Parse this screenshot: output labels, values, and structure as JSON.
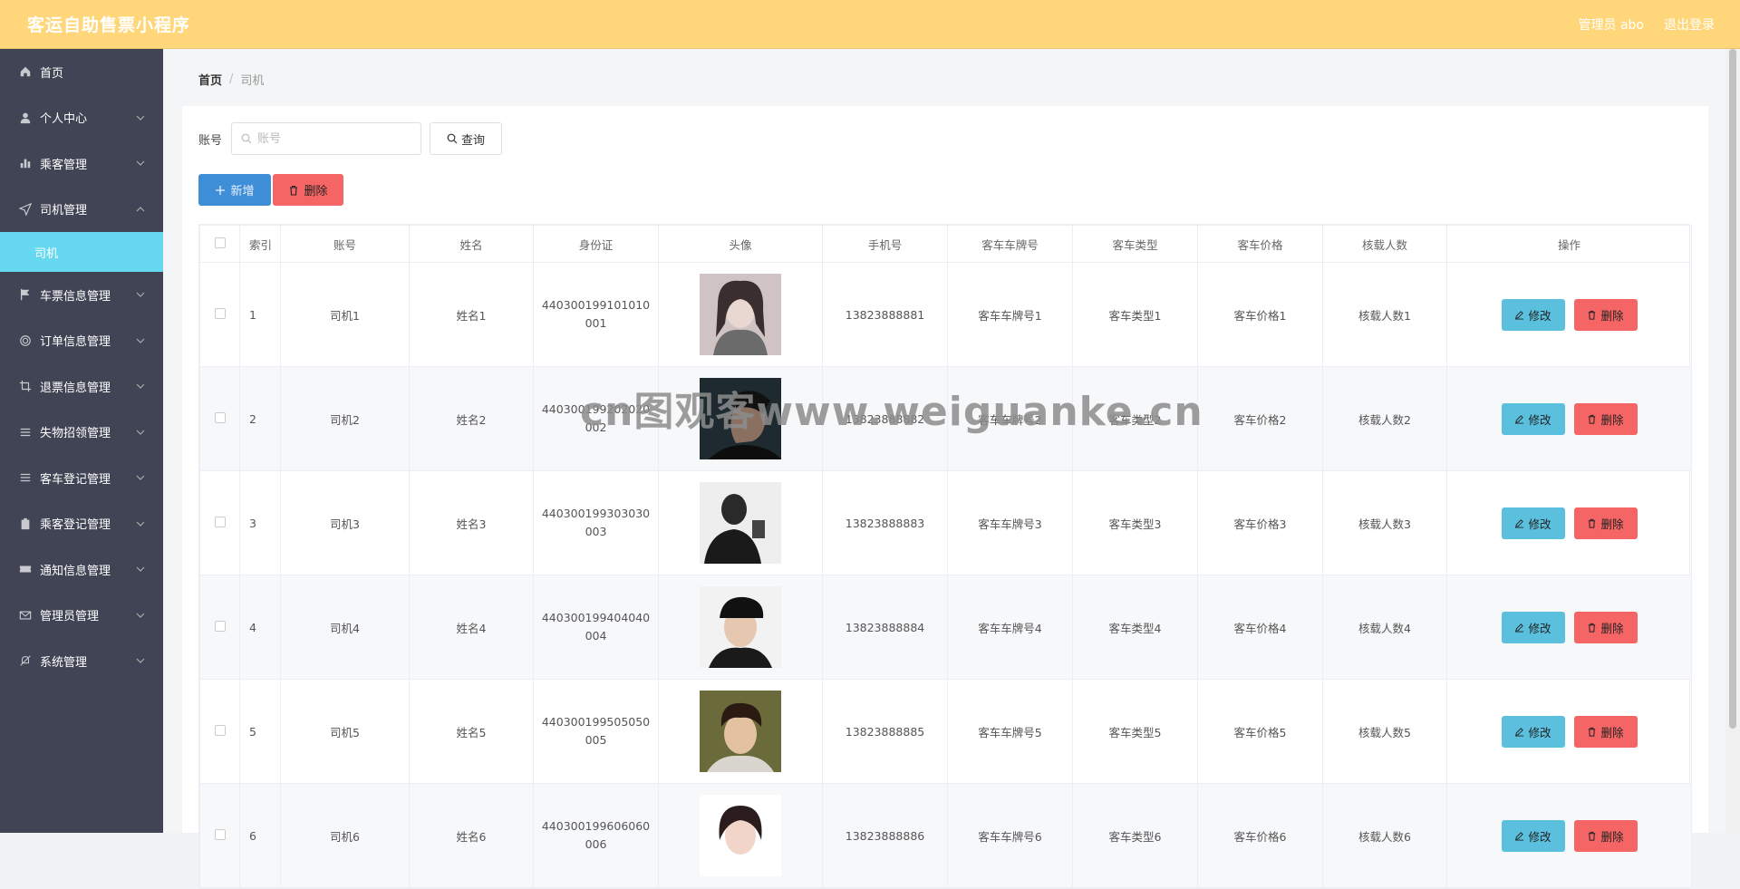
{
  "header": {
    "title": "客运自助售票小程序",
    "admin": "管理员 abo",
    "logout": "退出登录"
  },
  "sidebar": {
    "items": [
      {
        "label": "首页",
        "icon": "home-icon"
      },
      {
        "label": "个人中心",
        "icon": "user-icon"
      },
      {
        "label": "乘客管理",
        "icon": "chart-icon"
      },
      {
        "label": "司机管理",
        "icon": "send-icon"
      },
      {
        "label": "车票信息管理",
        "icon": "flag-icon"
      },
      {
        "label": "订单信息管理",
        "icon": "circle-icon"
      },
      {
        "label": "退票信息管理",
        "icon": "crop-icon"
      },
      {
        "label": "失物招领管理",
        "icon": "list-icon"
      },
      {
        "label": "客车登记管理",
        "icon": "list-icon"
      },
      {
        "label": "乘客登记管理",
        "icon": "clipboard-icon"
      },
      {
        "label": "通知信息管理",
        "icon": "ticket-icon"
      },
      {
        "label": "管理员管理",
        "icon": "mail-icon"
      },
      {
        "label": "系统管理",
        "icon": "bell-off-icon"
      }
    ],
    "sub_item": "司机"
  },
  "breadcrumb": {
    "home": "首页",
    "sep": "/",
    "current": "司机"
  },
  "search": {
    "label": "账号",
    "placeholder": "账号",
    "button": "查询"
  },
  "actions": {
    "add": "新增",
    "delete": "删除"
  },
  "table": {
    "headers": [
      "",
      "索引",
      "账号",
      "姓名",
      "身份证",
      "头像",
      "手机号",
      "客车车牌号",
      "客车类型",
      "客车价格",
      "核载人数",
      "操作"
    ],
    "edit_label": "修改",
    "delete_label": "删除",
    "rows": [
      {
        "idx": "1",
        "account": "司机1",
        "name": "姓名1",
        "id_card": "440300199101010001",
        "phone": "13823888881",
        "plate": "客车车牌号1",
        "type": "客车类型1",
        "price": "客车价格1",
        "capacity": "核载人数1"
      },
      {
        "idx": "2",
        "account": "司机2",
        "name": "姓名2",
        "id_card": "440300199202020002",
        "phone": "13823888882",
        "plate": "客车车牌号2",
        "type": "客车类型2",
        "price": "客车价格2",
        "capacity": "核载人数2"
      },
      {
        "idx": "3",
        "account": "司机3",
        "name": "姓名3",
        "id_card": "440300199303030003",
        "phone": "13823888883",
        "plate": "客车车牌号3",
        "type": "客车类型3",
        "price": "客车价格3",
        "capacity": "核载人数3"
      },
      {
        "idx": "4",
        "account": "司机4",
        "name": "姓名4",
        "id_card": "440300199404040004",
        "phone": "13823888884",
        "plate": "客车车牌号4",
        "type": "客车类型4",
        "price": "客车价格4",
        "capacity": "核载人数4"
      },
      {
        "idx": "5",
        "account": "司机5",
        "name": "姓名5",
        "id_card": "440300199505050005",
        "phone": "13823888885",
        "plate": "客车车牌号5",
        "type": "客车类型5",
        "price": "客车价格5",
        "capacity": "核载人数5"
      },
      {
        "idx": "6",
        "account": "司机6",
        "name": "姓名6",
        "id_card": "440300199606060006",
        "phone": "13823888886",
        "plate": "客车车牌号6",
        "type": "客车类型6",
        "price": "客车价格6",
        "capacity": "核载人数6"
      }
    ]
  },
  "watermark": "cn图观客www.weiguanke.cn",
  "colors": {
    "topbar": "#ffd77a",
    "sidebar": "#404454",
    "active_sub": "#66d9f0",
    "primary": "#3f8ed8",
    "danger": "#f56565",
    "info": "#5bc0de"
  }
}
